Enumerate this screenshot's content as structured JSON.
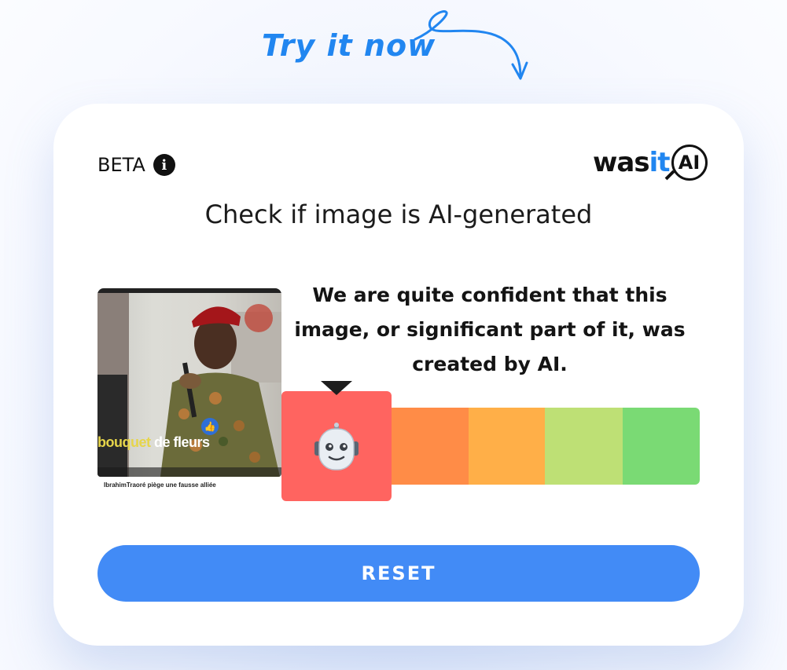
{
  "header": {
    "try_now": "Try it now"
  },
  "card": {
    "beta_label": "BETA",
    "logo": {
      "part1": "was",
      "part2": "it",
      "part3": "AI"
    },
    "headline": "Check if image is AI-generated",
    "thumbnail": {
      "overlay_word1": "bouquet",
      "overlay_word2": "de fleurs",
      "caption": "IbrahimTraoré piège une fausse alliée"
    },
    "verdict": "We are quite confident that this image, or significant part of it, was created by AI.",
    "scale": {
      "active_index": 0,
      "colors": [
        "#ff6460",
        "#ff8c47",
        "#ffaf48",
        "#bee075",
        "#7ada74"
      ],
      "active_icon": "robot-face-icon"
    },
    "reset_label": "RESET"
  },
  "colors": {
    "accent": "#2186f0",
    "button": "#428bf6"
  }
}
